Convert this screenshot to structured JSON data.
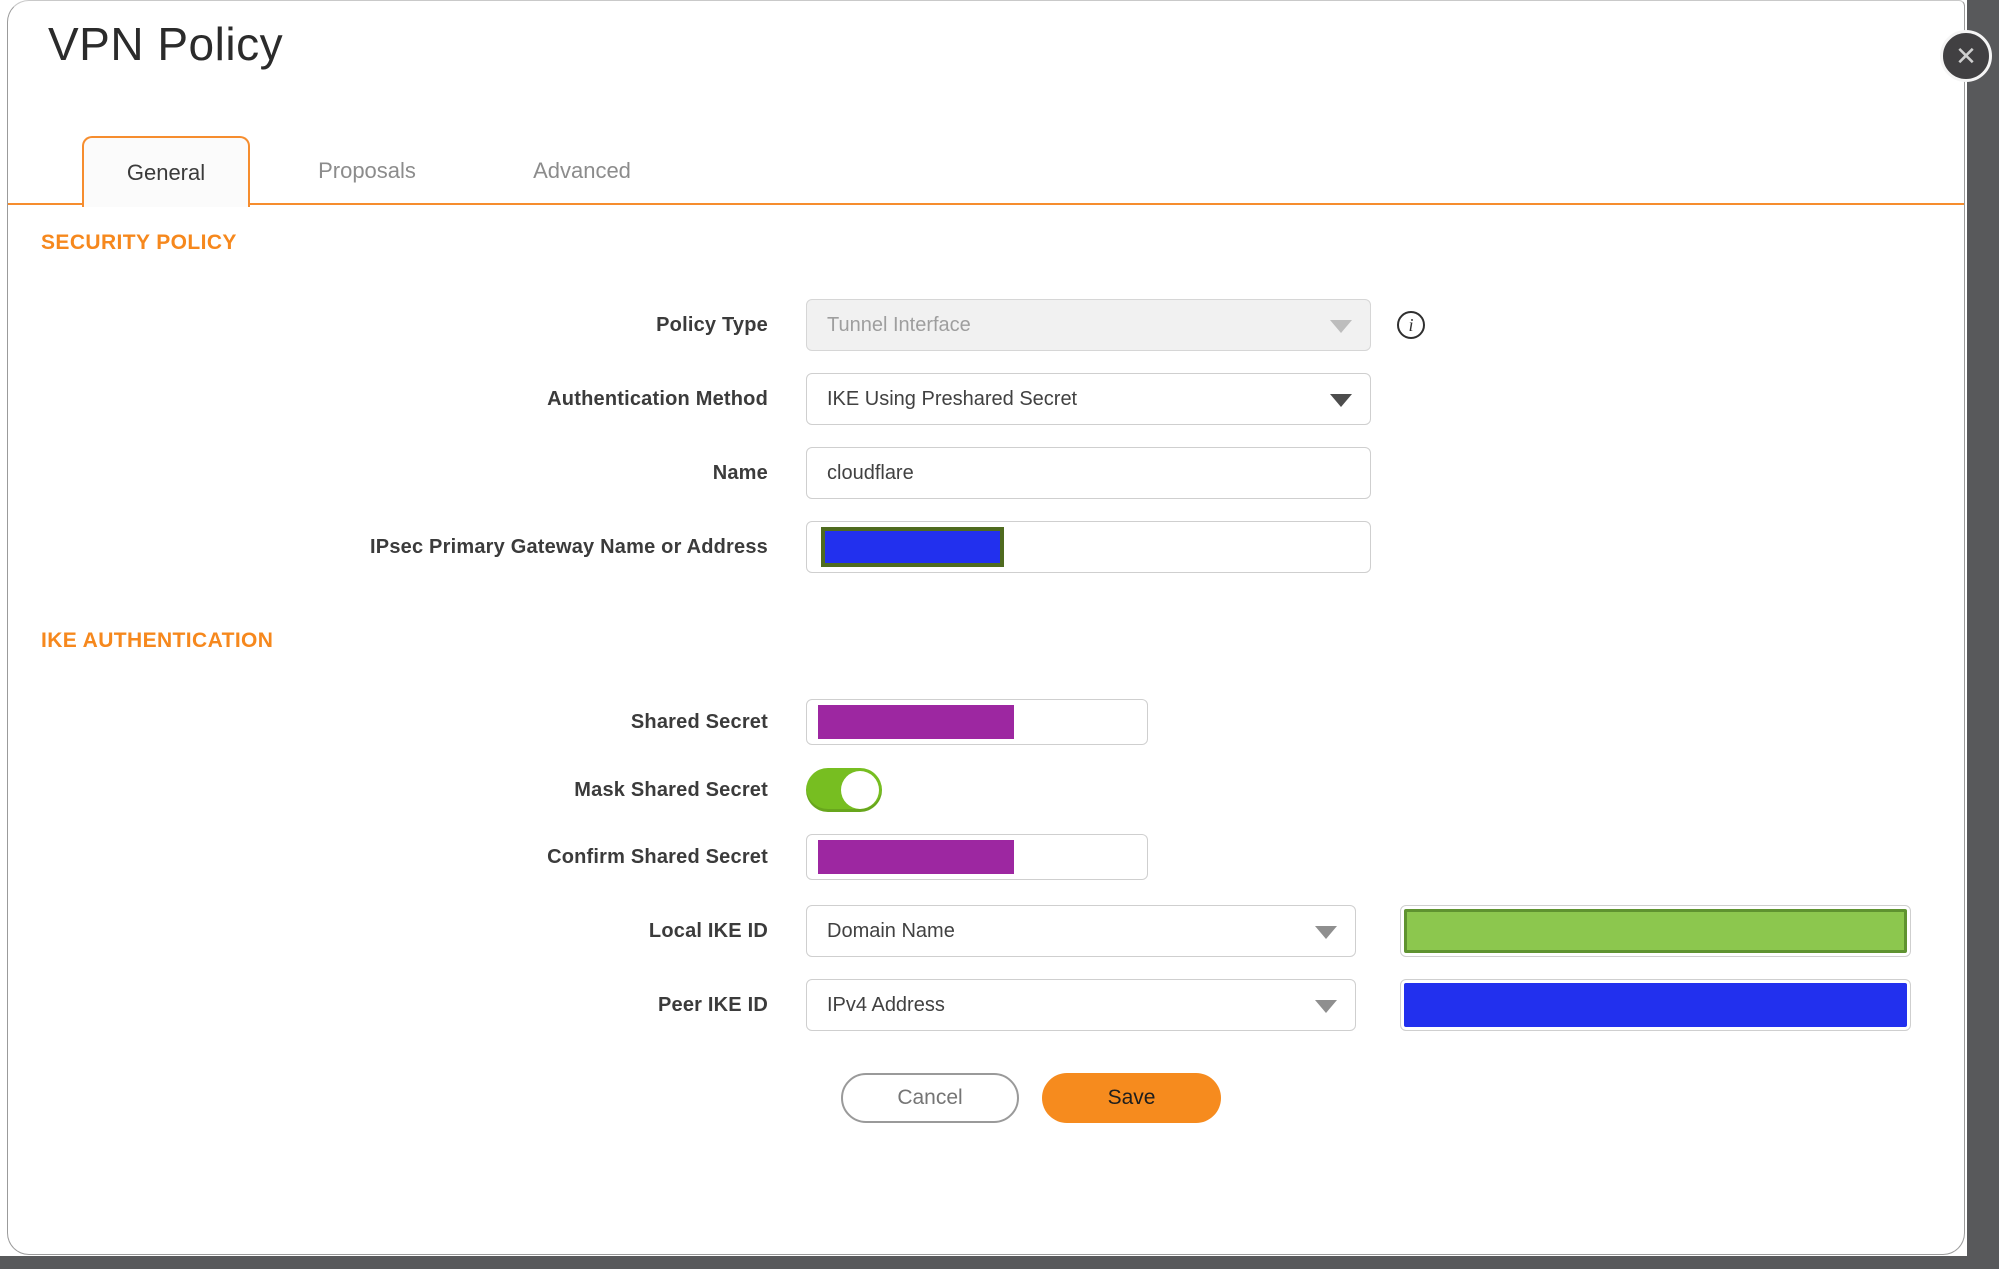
{
  "dialog": {
    "title": "VPN Policy",
    "close_icon": "✕"
  },
  "tabs": [
    {
      "label": "General",
      "active": true
    },
    {
      "label": "Proposals",
      "active": false
    },
    {
      "label": "Advanced",
      "active": false
    }
  ],
  "security_policy": {
    "heading": "SECURITY POLICY",
    "policy_type": {
      "label": "Policy Type",
      "value": "Tunnel Interface",
      "disabled": true
    },
    "auth_method": {
      "label": "Authentication Method",
      "value": "IKE Using Preshared Secret"
    },
    "name": {
      "label": "Name",
      "value": "cloudflare"
    },
    "gateway": {
      "label": "IPsec Primary Gateway Name or Address",
      "value": "",
      "redacted": true,
      "redaction_color": "#2230ee"
    }
  },
  "ike_authentication": {
    "heading": "IKE AUTHENTICATION",
    "shared_secret": {
      "label": "Shared Secret",
      "value": "",
      "redacted": true,
      "redaction_color": "#9d27a1"
    },
    "mask_shared_secret": {
      "label": "Mask Shared Secret",
      "state": "on"
    },
    "confirm_shared_secret": {
      "label": "Confirm Shared Secret",
      "value": "",
      "redacted": true,
      "redaction_color": "#9d27a1"
    },
    "local_ike_id": {
      "label": "Local IKE ID",
      "value": "Domain Name",
      "redacted_value_color": "#8cc74e"
    },
    "peer_ike_id": {
      "label": "Peer IKE ID",
      "value": "IPv4 Address",
      "redacted_value_color": "#2230ee"
    }
  },
  "buttons": {
    "cancel": "Cancel",
    "save": "Save"
  },
  "colors": {
    "accent_orange": "#f68b1e",
    "section_heading": "#f6881d",
    "toggle_on_green": "#77be21",
    "redaction_blue": "#2230ee",
    "redaction_purple": "#9d27a1",
    "redaction_green": "#8cc74e",
    "redaction_green_border": "#5f9330",
    "redaction_olive_border": "#4f6b1f",
    "page_background": "#58595b"
  }
}
